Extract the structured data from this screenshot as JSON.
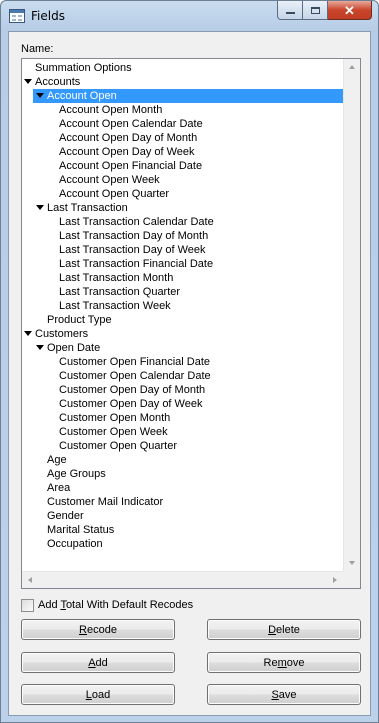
{
  "window": {
    "title": "Fields",
    "minimize_glyph": "minimize-icon",
    "maximize_glyph": "maximize-icon",
    "close_glyph": "✕"
  },
  "name_label": "Name:",
  "tree": {
    "items": [
      {
        "label": "Summation Options",
        "level": 1,
        "expander": false,
        "selected": false
      },
      {
        "label": "Accounts",
        "level": 1,
        "expander": true,
        "selected": false
      },
      {
        "label": "Account Open",
        "level": 2,
        "expander": true,
        "selected": true
      },
      {
        "label": "Account Open Month",
        "level": 3,
        "expander": false,
        "selected": false
      },
      {
        "label": "Account Open Calendar Date",
        "level": 3,
        "expander": false,
        "selected": false
      },
      {
        "label": "Account Open Day of Month",
        "level": 3,
        "expander": false,
        "selected": false
      },
      {
        "label": "Account Open Day of Week",
        "level": 3,
        "expander": false,
        "selected": false
      },
      {
        "label": "Account Open Financial Date",
        "level": 3,
        "expander": false,
        "selected": false
      },
      {
        "label": "Account Open Week",
        "level": 3,
        "expander": false,
        "selected": false
      },
      {
        "label": "Account Open Quarter",
        "level": 3,
        "expander": false,
        "selected": false
      },
      {
        "label": "Last Transaction",
        "level": 2,
        "expander": true,
        "selected": false
      },
      {
        "label": "Last Transaction Calendar Date",
        "level": 3,
        "expander": false,
        "selected": false
      },
      {
        "label": "Last Transaction Day of Month",
        "level": 3,
        "expander": false,
        "selected": false
      },
      {
        "label": "Last Transaction Day of Week",
        "level": 3,
        "expander": false,
        "selected": false
      },
      {
        "label": "Last Transaction Financial Date",
        "level": 3,
        "expander": false,
        "selected": false
      },
      {
        "label": "Last Transaction Month",
        "level": 3,
        "expander": false,
        "selected": false
      },
      {
        "label": "Last Transaction Quarter",
        "level": 3,
        "expander": false,
        "selected": false
      },
      {
        "label": "Last Transaction Week",
        "level": 3,
        "expander": false,
        "selected": false
      },
      {
        "label": "Product Type",
        "level": 2,
        "expander": false,
        "selected": false
      },
      {
        "label": "Customers",
        "level": 1,
        "expander": true,
        "selected": false
      },
      {
        "label": "Open Date",
        "level": 2,
        "expander": true,
        "selected": false
      },
      {
        "label": "Customer Open Financial Date",
        "level": 3,
        "expander": false,
        "selected": false
      },
      {
        "label": "Customer Open Calendar Date",
        "level": 3,
        "expander": false,
        "selected": false
      },
      {
        "label": "Customer Open Day of Month",
        "level": 3,
        "expander": false,
        "selected": false
      },
      {
        "label": "Customer Open Day of Week",
        "level": 3,
        "expander": false,
        "selected": false
      },
      {
        "label": "Customer Open Month",
        "level": 3,
        "expander": false,
        "selected": false
      },
      {
        "label": "Customer Open Week",
        "level": 3,
        "expander": false,
        "selected": false
      },
      {
        "label": "Customer Open Quarter",
        "level": 3,
        "expander": false,
        "selected": false
      },
      {
        "label": "Age",
        "level": 2,
        "expander": false,
        "selected": false
      },
      {
        "label": "Age Groups",
        "level": 2,
        "expander": false,
        "selected": false
      },
      {
        "label": "Area",
        "level": 2,
        "expander": false,
        "selected": false
      },
      {
        "label": "Customer Mail Indicator",
        "level": 2,
        "expander": false,
        "selected": false
      },
      {
        "label": "Gender",
        "level": 2,
        "expander": false,
        "selected": false
      },
      {
        "label": "Marital Status",
        "level": 2,
        "expander": false,
        "selected": false
      },
      {
        "label": "Occupation",
        "level": 2,
        "expander": false,
        "selected": false
      }
    ],
    "selection_color": "#3399ff"
  },
  "checkbox": {
    "label_before": "Add ",
    "label_mnemonic": "T",
    "label_after": "otal With Default Recodes",
    "checked": false
  },
  "buttons": {
    "recode": {
      "mnemonic": "R",
      "rest": "ecode"
    },
    "delete": {
      "mnemonic": "D",
      "rest": "elete"
    },
    "add": {
      "mnemonic": "A",
      "rest": "dd"
    },
    "remove": {
      "mnemonic_pre": "Re",
      "mnemonic": "m",
      "rest": "ove"
    },
    "load": {
      "mnemonic": "L",
      "rest": "oad"
    },
    "save": {
      "mnemonic": "S",
      "rest": "ave"
    }
  }
}
